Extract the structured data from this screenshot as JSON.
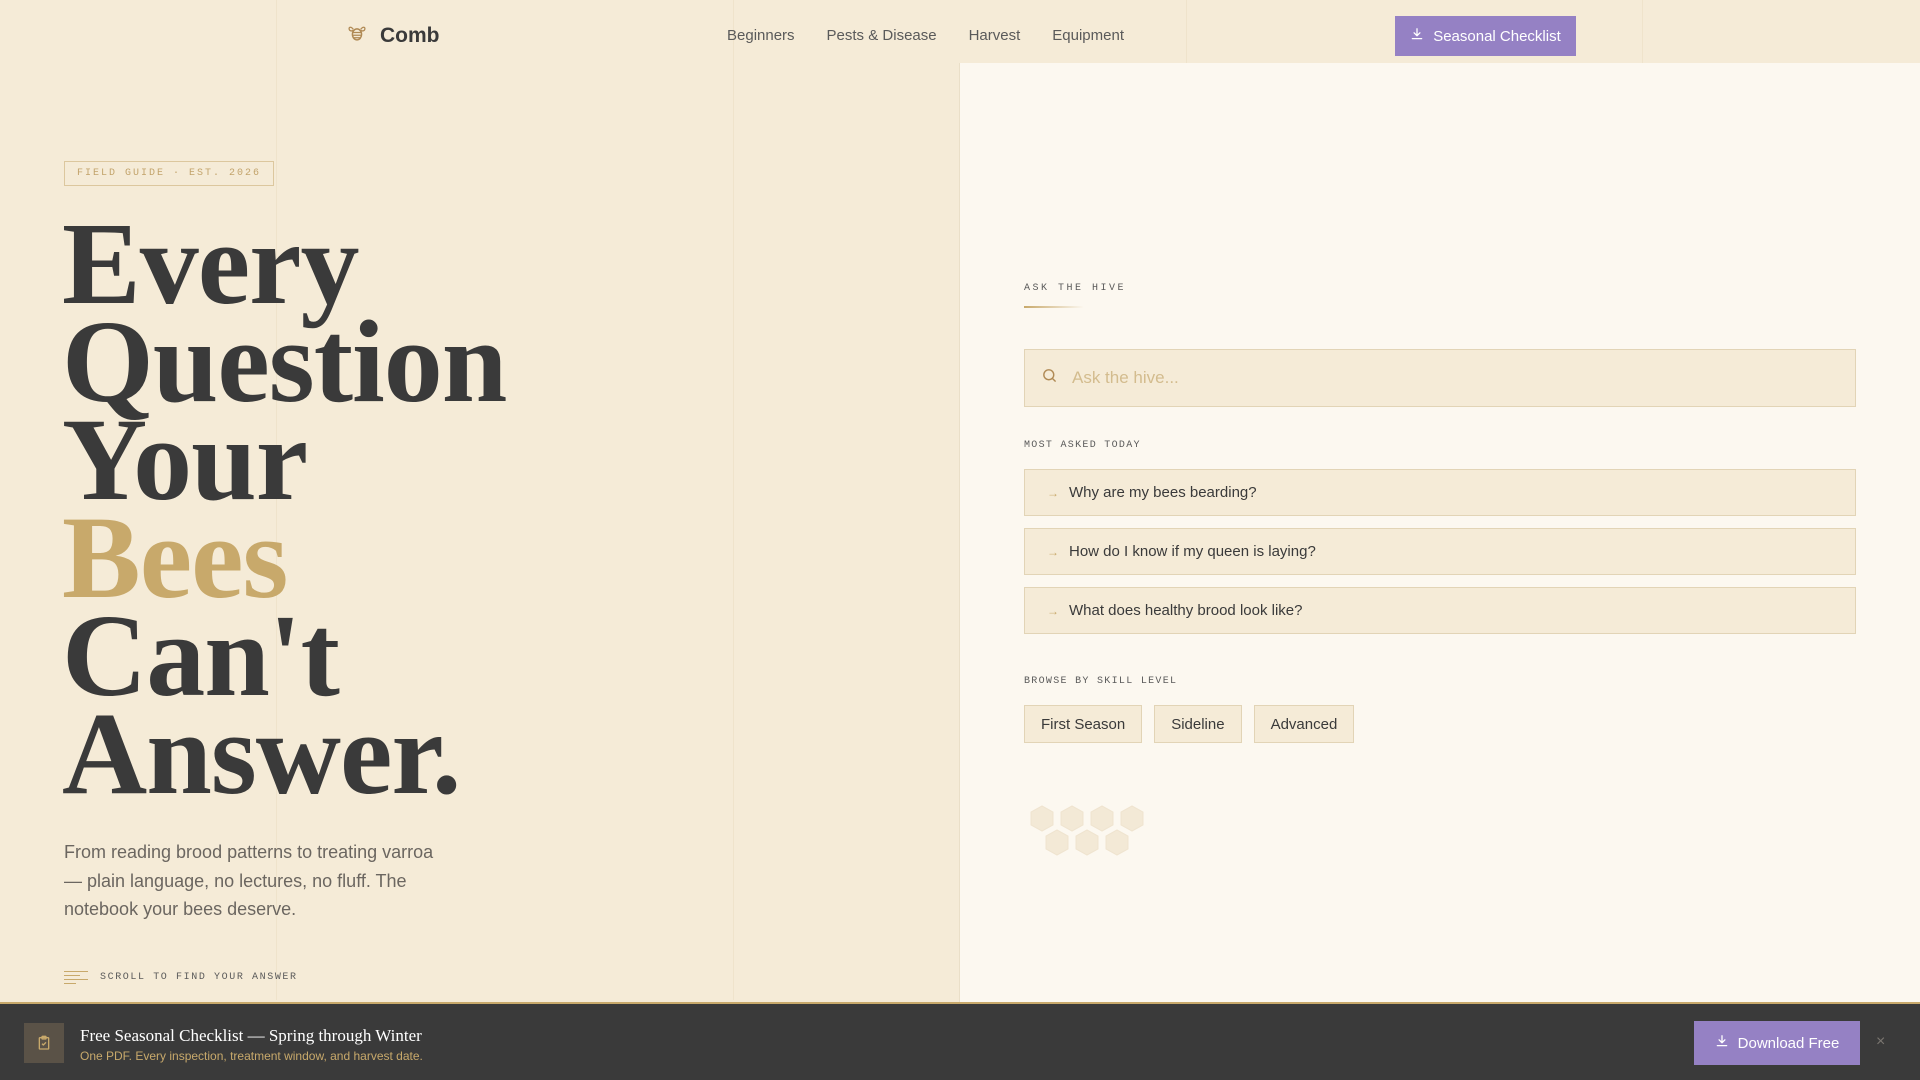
{
  "header": {
    "logo": "Comb",
    "nav": [
      "Beginners",
      "Pests & Disease",
      "Harvest",
      "Equipment"
    ],
    "cta": "Seasonal Checklist"
  },
  "hero": {
    "badge": "FIELD GUIDE · EST. 2026",
    "headline": [
      "Every",
      "Question",
      "Your",
      "Bees",
      "Can't",
      "Answer."
    ],
    "lede": "From reading brood patterns to treating varroa — plain language, no lectures, no fluff. The notebook your bees deserve.",
    "scroll": "SCROLL TO FIND YOUR ANSWER"
  },
  "panel": {
    "eyebrow": "ASK THE HIVE",
    "search_placeholder": "Ask the hive...",
    "most_asked_label": "MOST ASKED TODAY",
    "questions": [
      "Why are my bees bearding?",
      "How do I know if my queen is laying?",
      "What does healthy brood look like?"
    ],
    "skill_label": "BROWSE BY SKILL LEVEL",
    "skills": [
      "First Season",
      "Sideline",
      "Advanced"
    ]
  },
  "banner": {
    "title": "Free Seasonal Checklist — Spring through Winter",
    "subtitle": "One PDF. Every inspection, treatment window, and harvest date.",
    "cta": "Download Free",
    "close": "×"
  },
  "colors": {
    "background": "#f5ebd7",
    "panel": "#fcf8f0",
    "accent_gold": "#c8a96b",
    "accent_purple": "#9581c4",
    "banner": "#3a3a3a"
  },
  "icons": [
    "bee-logo-icon",
    "download-icon",
    "search-icon",
    "arrow-right-icon",
    "clipboard-icon",
    "close-icon",
    "honeycomb-decoration"
  ]
}
